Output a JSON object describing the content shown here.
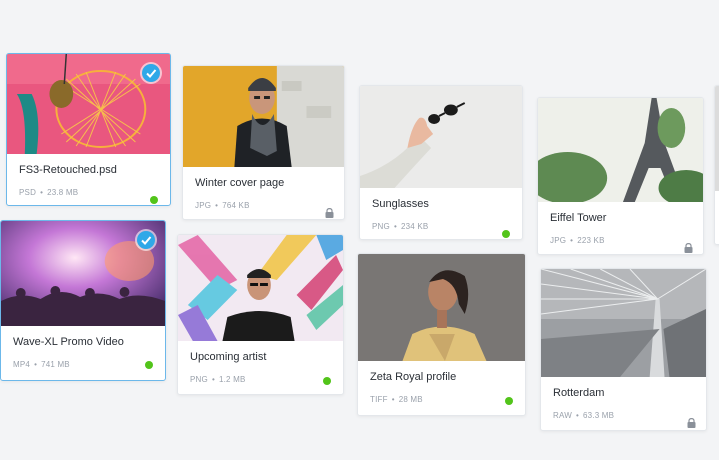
{
  "files": [
    {
      "name": "FS3-Retouched.psd",
      "type": "PSD",
      "size": "23.8 MB",
      "status": "online",
      "selected": true
    },
    {
      "name": "Winter cover page",
      "type": "JPG",
      "size": "764 KB",
      "status": "locked",
      "selected": false
    },
    {
      "name": "Sunglasses",
      "type": "PNG",
      "size": "234 KB",
      "status": "online",
      "selected": false
    },
    {
      "name": "Eiffel Tower",
      "type": "JPG",
      "size": "223 KB",
      "status": "locked",
      "selected": false
    },
    {
      "name": "Wave-XL Promo Video",
      "type": "MP4",
      "size": "741 MB",
      "status": "online",
      "selected": true
    },
    {
      "name": "Upcoming artist",
      "type": "PNG",
      "size": "1.2 MB",
      "status": "online",
      "selected": false
    },
    {
      "name": "Zeta Royal profile",
      "type": "TIFF",
      "size": "28 MB",
      "status": "online",
      "selected": false
    },
    {
      "name": "Rotterdam",
      "type": "RAW",
      "size": "63.3 MB",
      "status": "locked",
      "selected": false
    }
  ],
  "colors": {
    "online": "#52c41a",
    "selection": "#2fa8e8"
  },
  "icons": {
    "locked": "lock-icon",
    "selected": "checkmark-icon"
  }
}
